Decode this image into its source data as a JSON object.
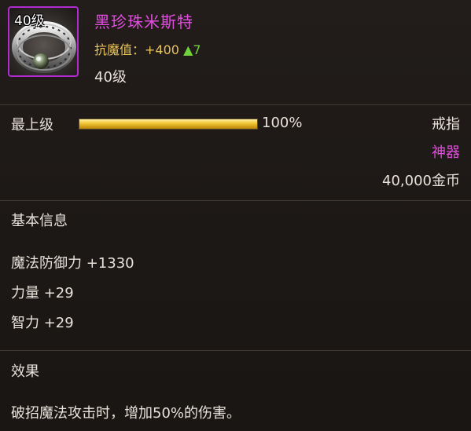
{
  "item": {
    "icon_level": "40级",
    "name": "黑珍珠米斯特",
    "stat_label": "抗魔值：",
    "stat_value": "+400",
    "stat_increase": "▲7",
    "required_level": "40级",
    "icon": "ring-icon"
  },
  "enhance": {
    "label": "最上级",
    "progress": 1.0,
    "percent_text": "100%"
  },
  "meta": {
    "type": "戒指",
    "rarity": "神器",
    "price": "40,000金币"
  },
  "basic_info": {
    "title": "基本信息",
    "attributes": [
      "魔法防御力 +1330",
      "力量 +29",
      "智力 +29"
    ]
  },
  "effect": {
    "title": "效果",
    "text": "破招魔法攻击时，增加50%的伤害。"
  },
  "colors": {
    "name": "#e24ddf",
    "rarity": "#e24ddf",
    "stat": "#e6c35a",
    "increase": "#6fd23a",
    "frame": "#b02bd0",
    "bar": "#f0c330"
  }
}
